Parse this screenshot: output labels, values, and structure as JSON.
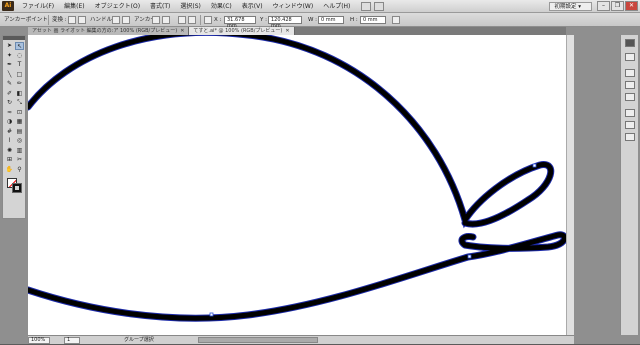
{
  "app": {
    "logo": "Ai"
  },
  "menu": [
    "ファイル(F)",
    "編集(E)",
    "オブジェクト(O)",
    "書式(T)",
    "選択(S)",
    "効果(C)",
    "表示(V)",
    "ウィンドウ(W)",
    "ヘルプ(H)"
  ],
  "workspace": {
    "label": "初期設定"
  },
  "window_controls": {
    "minimize": "–",
    "restore": "❐",
    "close": "✕"
  },
  "controlbar": {
    "selection_label": "アンカーポイント",
    "convert_label": "変換 :",
    "handle_label": "ハンドル :",
    "anchor_label": "アンカー :",
    "x_label": "X :",
    "x_value": "31.678 mm",
    "y_label": "Y :",
    "y_value": "120.428 mm",
    "w_label": "W :",
    "w_value": "0 mm",
    "h_label": "H :",
    "h_value": "0 mm"
  },
  "tabs": [
    {
      "label": "アセット 画 ライオット 編集の方の:ア 100% (RGB/プレビュー)",
      "active": false
    },
    {
      "label": "てすと.ai* @ 100% (RGB/プレビュー)",
      "active": true
    }
  ],
  "tab_close": "✕",
  "tools": [
    {
      "name": "selection-tool-icon",
      "glyph": "➤",
      "active": false
    },
    {
      "name": "direct-selection-tool-icon",
      "glyph": "↖",
      "active": true
    },
    {
      "name": "magic-wand-tool-icon",
      "glyph": "✦",
      "active": false
    },
    {
      "name": "lasso-tool-icon",
      "glyph": "◌",
      "active": false
    },
    {
      "name": "pen-tool-icon",
      "glyph": "✒",
      "active": false
    },
    {
      "name": "type-tool-icon",
      "glyph": "T",
      "active": false
    },
    {
      "name": "line-tool-icon",
      "glyph": "╲",
      "active": false
    },
    {
      "name": "rectangle-tool-icon",
      "glyph": "□",
      "active": false
    },
    {
      "name": "paintbrush-tool-icon",
      "glyph": "✎",
      "active": false
    },
    {
      "name": "pencil-tool-icon",
      "glyph": "✏",
      "active": false
    },
    {
      "name": "blob-brush-tool-icon",
      "glyph": "✐",
      "active": false
    },
    {
      "name": "eraser-tool-icon",
      "glyph": "◧",
      "active": false
    },
    {
      "name": "rotate-tool-icon",
      "glyph": "↻",
      "active": false
    },
    {
      "name": "scale-tool-icon",
      "glyph": "⤡",
      "active": false
    },
    {
      "name": "warp-tool-icon",
      "glyph": "≈",
      "active": false
    },
    {
      "name": "free-transform-tool-icon",
      "glyph": "⊡",
      "active": false
    },
    {
      "name": "shape-builder-tool-icon",
      "glyph": "◑",
      "active": false
    },
    {
      "name": "perspective-grid-tool-icon",
      "glyph": "▦",
      "active": false
    },
    {
      "name": "mesh-tool-icon",
      "glyph": "#",
      "active": false
    },
    {
      "name": "gradient-tool-icon",
      "glyph": "▤",
      "active": false
    },
    {
      "name": "eyedropper-tool-icon",
      "glyph": "⌇",
      "active": false
    },
    {
      "name": "blend-tool-icon",
      "glyph": "◎",
      "active": false
    },
    {
      "name": "symbol-sprayer-tool-icon",
      "glyph": "✺",
      "active": false
    },
    {
      "name": "graph-tool-icon",
      "glyph": "▥",
      "active": false
    },
    {
      "name": "artboard-tool-icon",
      "glyph": "⊞",
      "active": false
    },
    {
      "name": "slice-tool-icon",
      "glyph": "✂",
      "active": false
    },
    {
      "name": "hand-tool-icon",
      "glyph": "✋",
      "active": false
    },
    {
      "name": "zoom-tool-icon",
      "glyph": "⚲",
      "active": false
    }
  ],
  "statusbar": {
    "zoom": "100%",
    "artboard": "1",
    "status": "グループ選択"
  },
  "colors": {
    "stroke": "#000000",
    "stroke_outline": "#1c2aa8",
    "canvas": "#ffffff"
  }
}
